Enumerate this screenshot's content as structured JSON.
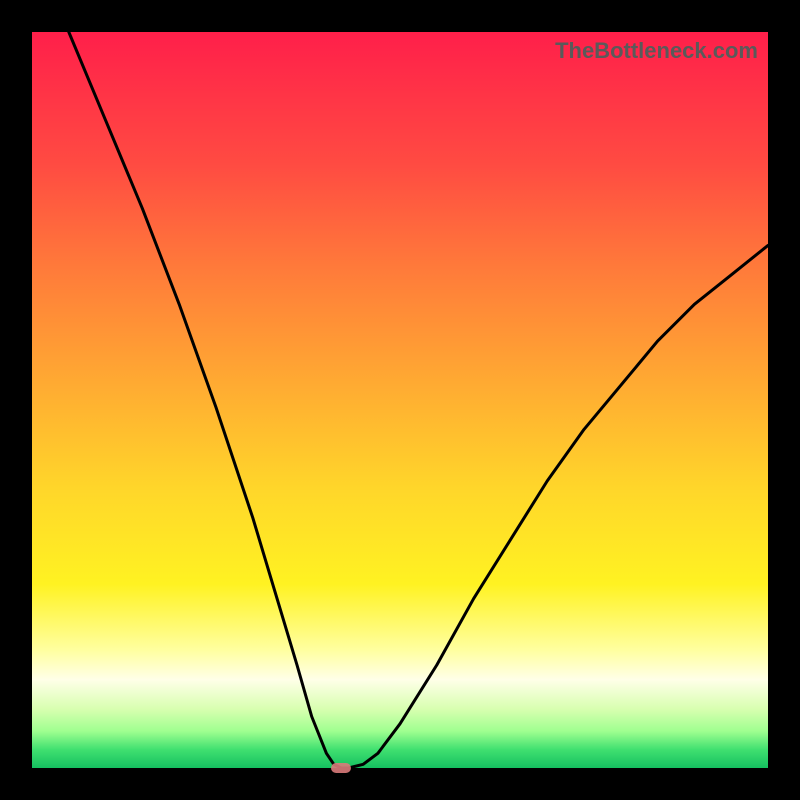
{
  "watermark": "TheBottleneck.com",
  "chart_data": {
    "type": "line",
    "title": "",
    "xlabel": "",
    "ylabel": "",
    "xlim": [
      0,
      100
    ],
    "ylim": [
      0,
      100
    ],
    "grid": false,
    "legend": false,
    "series": [
      {
        "name": "curve",
        "x": [
          5,
          10,
          15,
          20,
          25,
          30,
          33,
          36,
          38,
          40,
          41,
          42,
          43,
          45,
          47,
          50,
          55,
          60,
          65,
          70,
          75,
          80,
          85,
          90,
          95,
          100
        ],
        "y": [
          100,
          88,
          76,
          63,
          49,
          34,
          24,
          14,
          7,
          2,
          0.5,
          0,
          0,
          0.5,
          2,
          6,
          14,
          23,
          31,
          39,
          46,
          52,
          58,
          63,
          67,
          71
        ]
      }
    ],
    "marker": {
      "x": 42,
      "y": 0
    }
  },
  "colors": {
    "curve": "#000000",
    "marker": "#d97a7a",
    "background_frame": "#000000"
  }
}
